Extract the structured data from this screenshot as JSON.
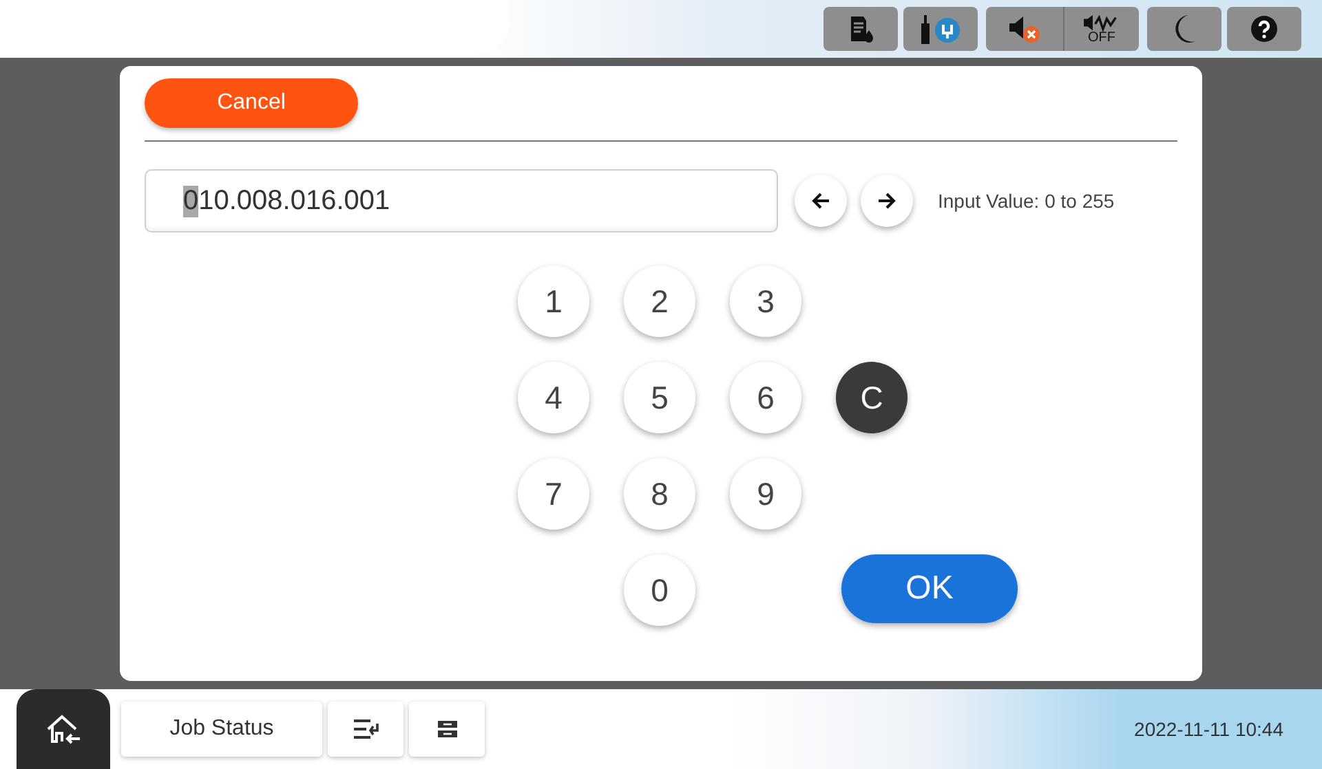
{
  "top_bar": {
    "status_icons": [
      {
        "kind": "ink"
      },
      {
        "kind": "network"
      },
      {
        "kind": "sound-off"
      },
      {
        "kind": "quiet-off",
        "label": "OFF"
      },
      {
        "kind": "sleep"
      },
      {
        "kind": "help"
      }
    ]
  },
  "dialog": {
    "cancel_button": "Cancel",
    "field": {
      "value_highlighted": "0",
      "value_rest": "10.008.016.001"
    },
    "cursor_buttons": [
      {
        "kind": "left"
      },
      {
        "kind": "right"
      }
    ],
    "hint": "Input Value: 0 to 255",
    "keypad": [
      [
        {
          "kind": "digit",
          "label": "1"
        },
        {
          "kind": "digit",
          "label": "2"
        },
        {
          "kind": "digit",
          "label": "3"
        }
      ],
      [
        {
          "kind": "digit",
          "label": "4"
        },
        {
          "kind": "digit",
          "label": "5"
        },
        {
          "kind": "digit",
          "label": "6"
        },
        {
          "kind": "clear",
          "label": "C"
        }
      ],
      [
        {
          "kind": "digit",
          "label": "7"
        },
        {
          "kind": "digit",
          "label": "8"
        },
        {
          "kind": "digit",
          "label": "9"
        }
      ],
      [
        {
          "kind": "digit",
          "label": "0"
        },
        {
          "kind": "ok",
          "label": "OK"
        }
      ]
    ]
  },
  "bottom_bar": {
    "job_status": "Job Status",
    "tool_icons": [
      {
        "kind": "job-list"
      },
      {
        "kind": "tray"
      }
    ],
    "datetime": "2022-11-11 10:44"
  }
}
